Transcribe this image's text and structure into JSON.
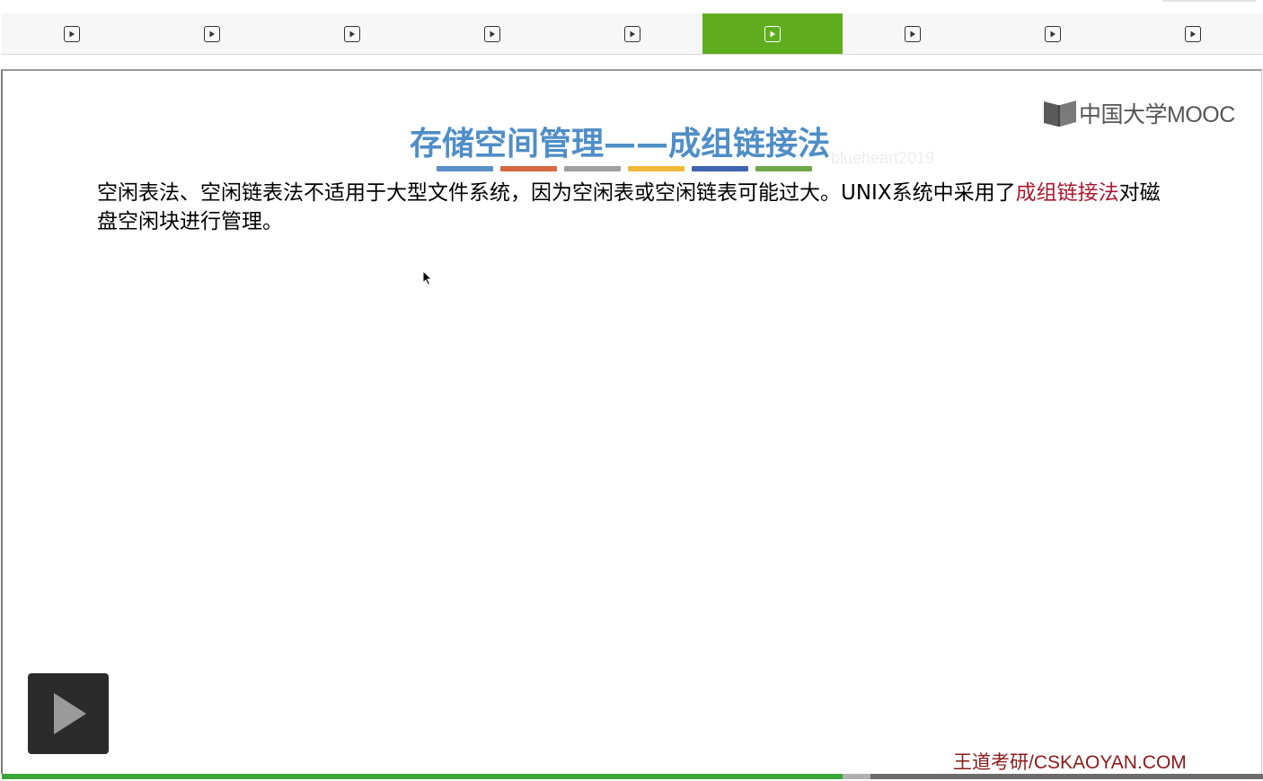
{
  "tabs": [
    {
      "icon": "play-square-icon",
      "active": false
    },
    {
      "icon": "play-square-icon",
      "active": false
    },
    {
      "icon": "play-square-icon",
      "active": false
    },
    {
      "icon": "play-square-icon",
      "active": false
    },
    {
      "icon": "play-square-icon",
      "active": false
    },
    {
      "icon": "play-square-icon",
      "active": true
    },
    {
      "icon": "play-square-icon",
      "active": false
    },
    {
      "icon": "play-square-icon",
      "active": false
    },
    {
      "icon": "play-square-icon",
      "active": false
    }
  ],
  "colors": {
    "active_tab": "#5fad1f",
    "title": "#4f8ec6",
    "highlight": "#a8192e",
    "progress": "#3aa637",
    "underline": [
      "#5b8fc8",
      "#d6693f",
      "#a0a0a0",
      "#f0b93a",
      "#3f63b0",
      "#6fa84a"
    ]
  },
  "slide": {
    "logo_text": "中国大学MOOC",
    "title": "存储空间管理——成组链接法",
    "watermark": "blueheart2019",
    "body_plain": "空闲表法、空闲链表法不适用于大型文件系统，因为空闲表或空闲链表可能过大。UNIX系统中采用了",
    "body_highlight": "成组链接法",
    "body_tail": "对磁盘空闲块进行管理。",
    "footer": "王道考研/CSKAOYAN.COM"
  },
  "player": {
    "play_icon": "play-icon",
    "progress_fraction": 0.667,
    "buffered_fraction": 0.689
  }
}
